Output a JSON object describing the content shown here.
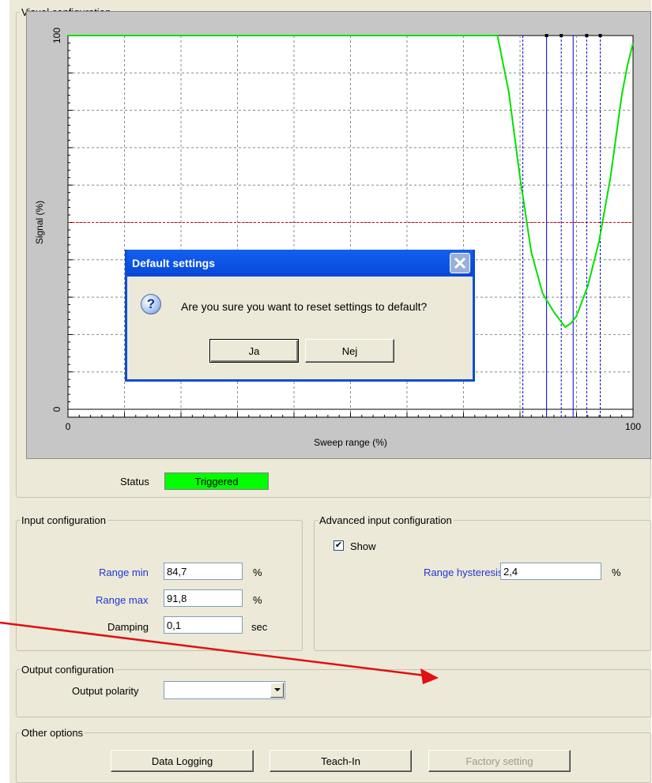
{
  "groups": {
    "visual": "Visual configuration",
    "input": "Input configuration",
    "advanced": "Advanced input configuration",
    "output": "Output configuration",
    "other": "Other options"
  },
  "chart_data": {
    "type": "line",
    "ylabel": "Signal (%)",
    "xlabel": "Sweep range (%)",
    "xlim": [
      0,
      100
    ],
    "ylim": [
      0,
      100
    ],
    "x_ticks": [
      "0",
      "100"
    ],
    "y_ticks": [
      "0",
      "100"
    ],
    "grid": true,
    "series": [
      {
        "color": "#00e000",
        "x": [
          0,
          76,
          78,
          80,
          82,
          84,
          86,
          87,
          88,
          89,
          90,
          92,
          94,
          96,
          98,
          99,
          100
        ],
        "y": [
          100,
          100,
          85,
          62,
          42,
          31,
          26,
          24,
          22,
          23,
          25,
          33,
          45,
          62,
          84,
          92,
          98
        ]
      }
    ],
    "threshold_line": {
      "y": 50,
      "color": "#e00000",
      "style": "dashed"
    },
    "vertical_markers": [
      {
        "x": 80.5,
        "color": "#0000e0",
        "style": "dashed"
      },
      {
        "x": 84.7,
        "color": "#0000e0",
        "style": "solid"
      },
      {
        "x": 87.3,
        "color": "#0000e0",
        "style": "dashed"
      },
      {
        "x": 89.4,
        "color": "#0000e0",
        "style": "solid"
      },
      {
        "x": 91.8,
        "color": "#0000e0",
        "style": "dashed"
      },
      {
        "x": 94.2,
        "color": "#0000e0",
        "style": "dashed"
      }
    ]
  },
  "status": {
    "label": "Status",
    "value": "Triggered",
    "color": "#00ff00"
  },
  "input": {
    "range_min_label": "Range min",
    "range_min_value": "84,7",
    "range_min_unit": "%",
    "range_max_label": "Range max",
    "range_max_value": "91,8",
    "range_max_unit": "%",
    "damping_label": "Damping",
    "damping_value": "0,1",
    "damping_unit": "sec"
  },
  "advanced": {
    "show_label": "Show",
    "show_checked": true,
    "hysteresis_label": "Range hysteresis",
    "hysteresis_value": "2,4",
    "hysteresis_unit": "%"
  },
  "output": {
    "polarity_label": "Output polarity",
    "polarity_value": ""
  },
  "other": {
    "data_logging": "Data Logging",
    "teach_in": "Teach-In",
    "factory_setting": "Factory setting"
  },
  "dialog": {
    "title": "Default settings",
    "message": "Are you sure you want to reset settings to default?",
    "yes": "Ja",
    "no": "Nej"
  },
  "annotation": {
    "arrow_color": "#e01010"
  }
}
